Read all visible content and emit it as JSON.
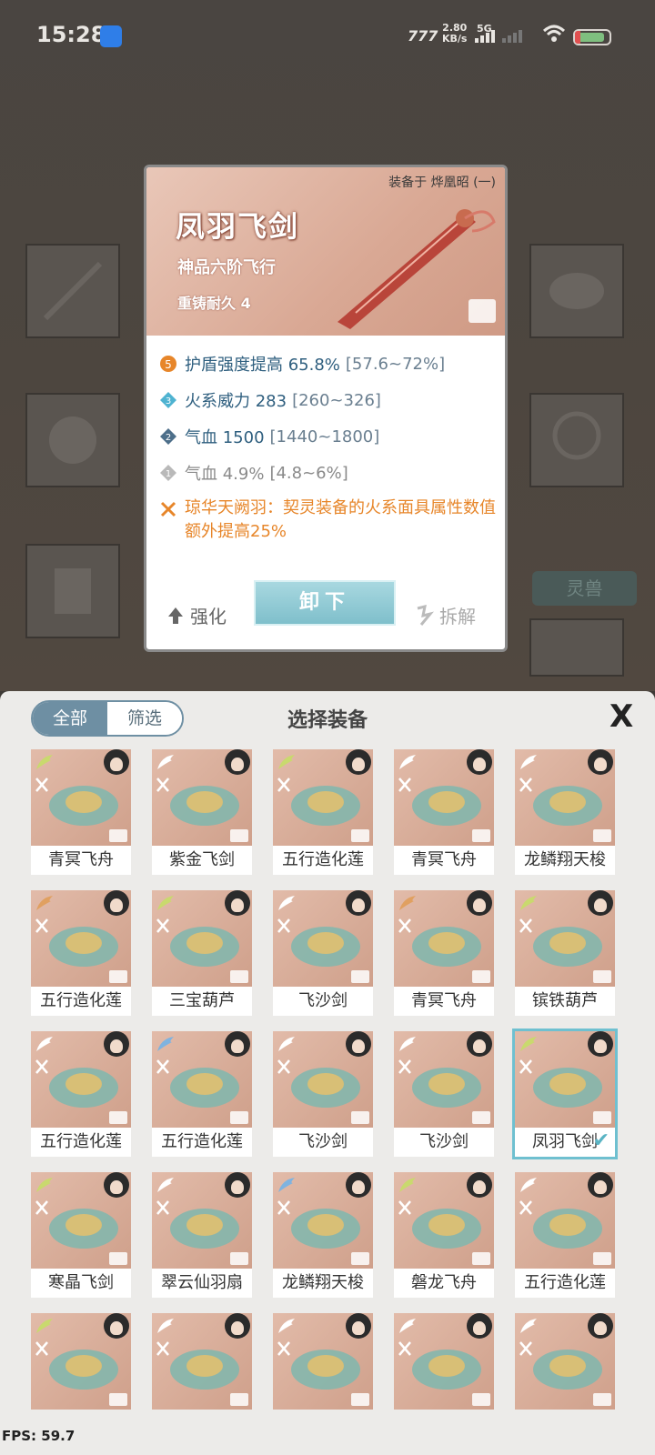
{
  "status_bar": {
    "time": "15:28",
    "network_label": "777",
    "speed_value": "2.80",
    "speed_unit": "KB/s",
    "cell_gen": "5G"
  },
  "background": {
    "pet_button": "灵兽"
  },
  "detail": {
    "equipped_on": "装备于 烨凰昭 (一)",
    "name": "凤羽飞剑",
    "grade": "神品六阶飞行",
    "durability": "重铸耐久 4",
    "stats": [
      {
        "badge": "5",
        "label": "护盾强度提高 65.8%",
        "range": "[57.6~72%]",
        "badge_color": "#e7862a"
      },
      {
        "badge": "3",
        "label": "火系威力 283",
        "range": "[260~326]",
        "badge_color": "#4fb3d1"
      },
      {
        "badge": "2",
        "label": "气血 1500",
        "range": "[1440~1800]",
        "badge_color": "#4d6f8a"
      },
      {
        "badge": "1",
        "label": "气血 4.9%",
        "range": "[4.8~6%]",
        "badge_color": "#b9b9b9"
      }
    ],
    "set_bonus": "琼华天阙羽：契灵装备的火系面具属性数值额外提高25%",
    "unequip_label": "卸下",
    "enhance_label": "强化",
    "dismantle_label": "拆解"
  },
  "panel": {
    "tab_all": "全部",
    "tab_filter": "筛选",
    "title": "选择装备",
    "close_glyph": "X",
    "items": [
      {
        "name": "青冥飞舟",
        "wing": "#c9d96e"
      },
      {
        "name": "紫金飞剑",
        "wing": "#ffffff"
      },
      {
        "name": "五行造化莲",
        "wing": "#c9d96e"
      },
      {
        "name": "青冥飞舟",
        "wing": "#ffffff"
      },
      {
        "name": "龙鳞翔天梭",
        "wing": "#ffffff"
      },
      {
        "name": "五行造化莲",
        "wing": "#e0a060"
      },
      {
        "name": "三宝葫芦",
        "wing": "#c9d96e"
      },
      {
        "name": "飞沙剑",
        "wing": "#ffffff"
      },
      {
        "name": "青冥飞舟",
        "wing": "#e0a060"
      },
      {
        "name": "镔铁葫芦",
        "wing": "#c9d96e"
      },
      {
        "name": "五行造化莲",
        "wing": "#ffffff"
      },
      {
        "name": "五行造化莲",
        "wing": "#7fb3e0"
      },
      {
        "name": "飞沙剑",
        "wing": "#ffffff"
      },
      {
        "name": "飞沙剑",
        "wing": "#ffffff"
      },
      {
        "name": "凤羽飞剑",
        "wing": "#c9d96e",
        "selected": true
      },
      {
        "name": "寒晶飞剑",
        "wing": "#c9d96e"
      },
      {
        "name": "翠云仙羽扇",
        "wing": "#ffffff"
      },
      {
        "name": "龙鳞翔天梭",
        "wing": "#7fb3e0"
      },
      {
        "name": "磐龙飞舟",
        "wing": "#c9d96e"
      },
      {
        "name": "五行造化莲",
        "wing": "#ffffff"
      },
      {
        "name": "",
        "wing": "#c9d96e"
      },
      {
        "name": "",
        "wing": "#ffffff"
      },
      {
        "name": "",
        "wing": "#ffffff"
      },
      {
        "name": "",
        "wing": "#ffffff"
      },
      {
        "name": "",
        "wing": "#ffffff"
      }
    ]
  },
  "fps_label": "FPS: 59.7"
}
